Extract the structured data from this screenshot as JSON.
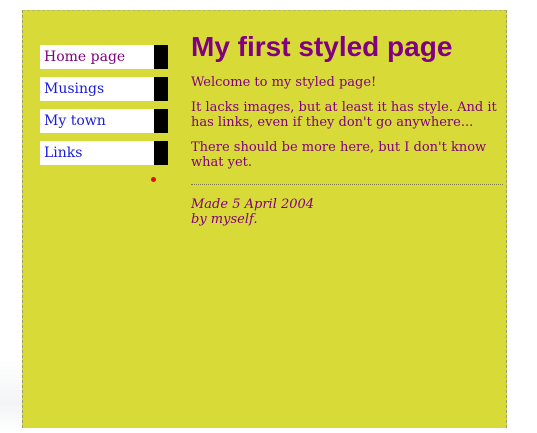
{
  "nav": [
    {
      "label": "Home page",
      "visited": true
    },
    {
      "label": "Musings",
      "visited": false
    },
    {
      "label": "My town",
      "visited": false
    },
    {
      "label": "Links",
      "visited": false
    }
  ],
  "content": {
    "title": "My first styled page",
    "paragraphs": [
      "Welcome to my styled page!",
      "It lacks images, but at least it has style. And it has links, even if they don't go anywhere...",
      "There should be more here, but I don't know what yet."
    ],
    "footer": {
      "made": "Made 5 April 2004",
      "by": "by myself."
    }
  },
  "colors": {
    "background": "#d8da38",
    "text": "#800080",
    "link": "#1a1ae0",
    "visited_link": "#800080",
    "nav_bar": "#000000"
  }
}
